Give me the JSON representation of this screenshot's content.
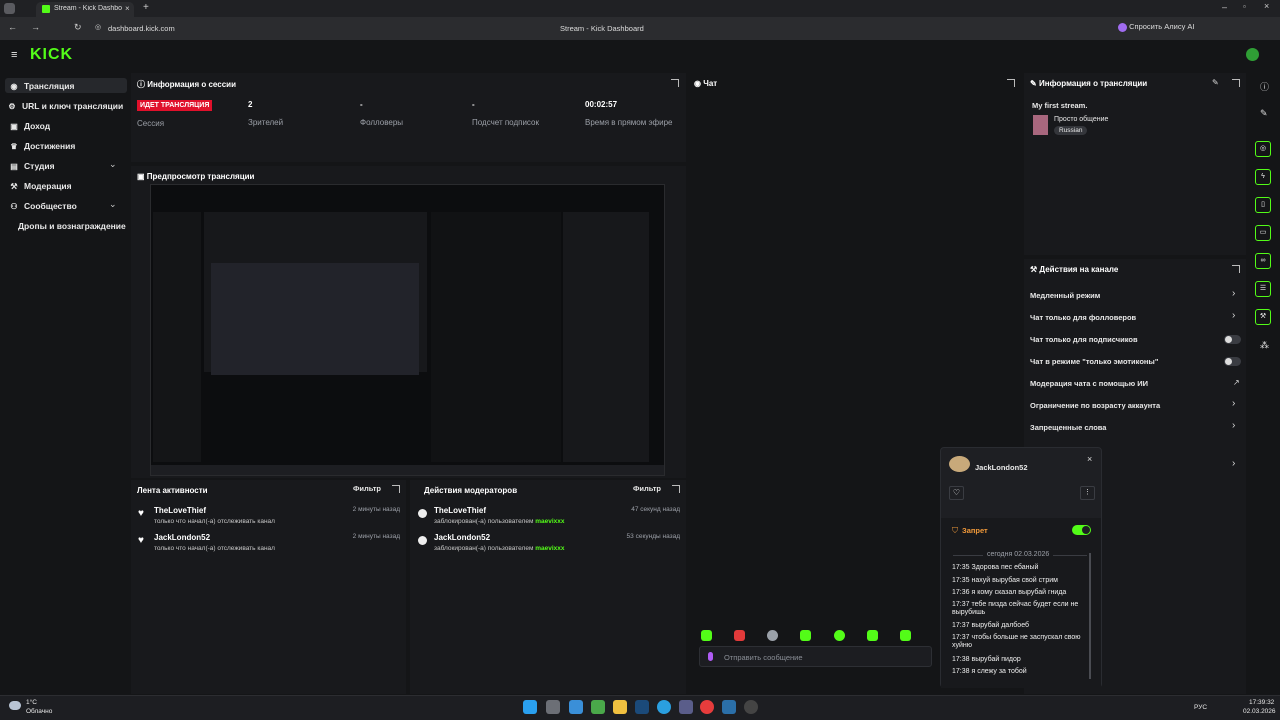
{
  "browser": {
    "tab_title": "Stream - Kick Dashboard",
    "url": "dashboard.kick.com",
    "window_title": "Stream - Kick Dashboard",
    "ask_ai": "Спросить Алису AI"
  },
  "brand": {
    "logo": "KICK",
    "accent": "#53fc18"
  },
  "sidebar": {
    "items": [
      {
        "label": "Трансляция",
        "icon": "broadcast-icon"
      },
      {
        "label": "URL и ключ трансляции",
        "icon": "gear-icon"
      },
      {
        "label": "Доход",
        "icon": "wallet-icon"
      },
      {
        "label": "Достижения",
        "icon": "trophy-icon"
      },
      {
        "label": "Студия",
        "icon": "studio-icon"
      },
      {
        "label": "Модерация",
        "icon": "hammer-icon"
      },
      {
        "label": "Сообщество",
        "icon": "community-icon"
      },
      {
        "label": "Дропы и вознаграждение",
        "icon": ""
      }
    ]
  },
  "session": {
    "title": "Информация о сессии",
    "live_badge": "ИДЕТ ТРАНСЛЯЦИЯ",
    "session_label": "Сессия",
    "stats": [
      {
        "value": "2",
        "label": "Зрителей"
      },
      {
        "value": "-",
        "label": "Фолловеры"
      },
      {
        "value": "-",
        "label": "Подсчет подписок"
      },
      {
        "value": "00:02:57",
        "label": "Время в прямом эфире"
      }
    ]
  },
  "preview": {
    "title": "Предпросмотр трансляции"
  },
  "activity": {
    "title": "Лента активности",
    "filter": "Фильтр",
    "rows": [
      {
        "name": "TheLoveThief",
        "desc": "только что начал(-а) отслеживать канал",
        "time": "2 минуты назад"
      },
      {
        "name": "JackLondon52",
        "desc": "только что начал(-а) отслеживать канал",
        "time": "2 минуты назад"
      }
    ]
  },
  "mod_actions": {
    "title": "Действия модераторов",
    "filter": "Фильтр",
    "rows": [
      {
        "name": "TheLoveThief",
        "desc": "заблокирован(-а) пользователем",
        "by": "maevixxx",
        "time": "47 секунд назад"
      },
      {
        "name": "JackLondon52",
        "desc": "заблокирован(-а) пользователем",
        "by": "maevixxx",
        "time": "53 секунды назад"
      }
    ]
  },
  "chat": {
    "title": "Чат",
    "input_placeholder": "Отправить сообщение"
  },
  "stream_info": {
    "title": "Информация о трансляции",
    "stream_title": "My first stream.",
    "category": "Просто общение",
    "language": "Russian"
  },
  "channel_actions": {
    "title": "Действия на канале",
    "items": [
      {
        "label": "Медленный режим",
        "control": "chevron"
      },
      {
        "label": "Чат только для фолловеров",
        "control": "chevron"
      },
      {
        "label": "Чат только для подписчиков",
        "control": "toggle",
        "state": false
      },
      {
        "label": "Чат в режиме \"только эмотиконы\"",
        "control": "toggle",
        "state": false
      },
      {
        "label": "Модерация чата с помощью ИИ",
        "control": "external"
      },
      {
        "label": "Ограничение по возрасту аккаунта",
        "control": "chevron"
      },
      {
        "label": "Запрещенные слова",
        "control": "chevron"
      }
    ]
  },
  "user_card": {
    "username": "JackLondon52",
    "ban_label": "Запрет",
    "ban_state": true,
    "date_divider": "сегодня 02.03.2026",
    "messages": [
      {
        "time": "17:35",
        "text": "Здорова пес ебаный"
      },
      {
        "time": "17:35",
        "text": "нахуй вырубая свой стрим"
      },
      {
        "time": "17:36",
        "text": "я кому сказал вырубай гнида"
      },
      {
        "time": "17:37",
        "text": "тебе пизда сейчас будет если не вырубишь"
      },
      {
        "time": "17:37",
        "text": "вырубай далбоеб"
      },
      {
        "time": "17:37",
        "text": "чтобы больше не заспускал свою хуйню"
      },
      {
        "time": "17:38",
        "text": "вырубай пидор"
      },
      {
        "time": "17:38",
        "text": "я слежу за тобой"
      }
    ]
  },
  "taskbar": {
    "weather_temp": "1°C",
    "weather_text": "Облачно",
    "lang": "РУС",
    "time": "17:39:32",
    "date": "02.03.2026"
  }
}
